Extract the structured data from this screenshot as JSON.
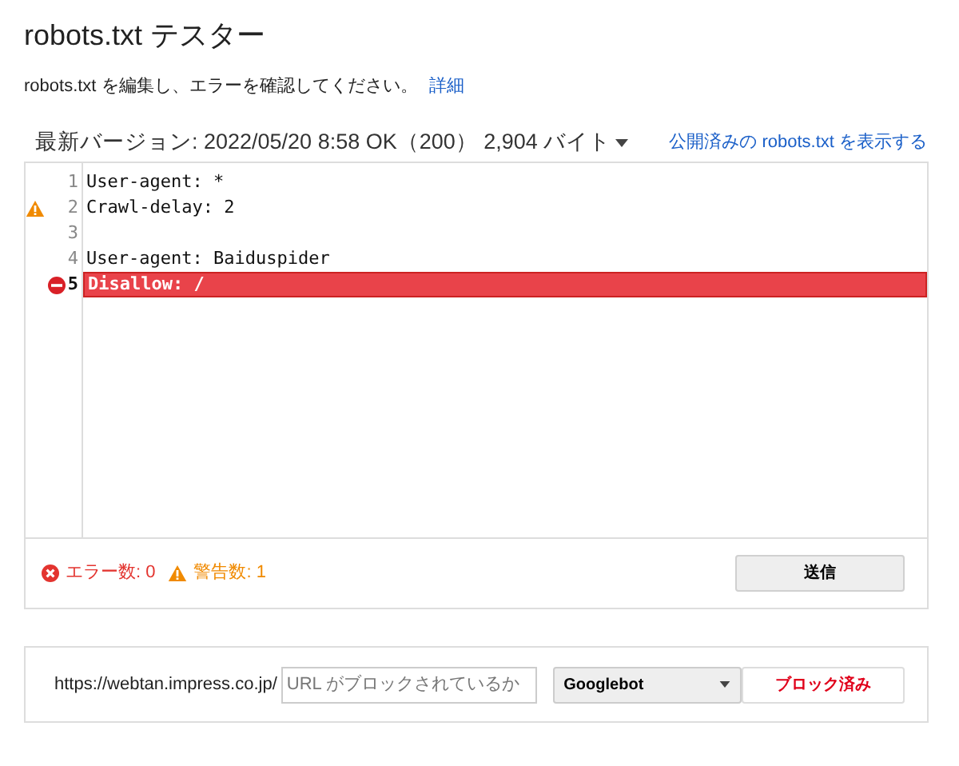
{
  "title": "robots.txt テスター",
  "intro": {
    "text": "robots.txt を編集し、エラーを確認してください。",
    "link": "詳細"
  },
  "version": {
    "label": "最新バージョン: 2022/05/20 8:58 OK（200） 2,904 バイト",
    "link": "公開済みの robots.txt を表示する"
  },
  "editor_lines": [
    {
      "number": "1",
      "text": "User-agent: *",
      "warning": false,
      "error": false
    },
    {
      "number": "2",
      "text": "Crawl-delay: 2",
      "warning": true,
      "error": false
    },
    {
      "number": "3",
      "warning": false,
      "error": false
    },
    {
      "number": "4",
      "text": "User-agent: Baiduspider",
      "warning": false,
      "error": false
    },
    {
      "number": "5",
      "text": "Disallow: /",
      "warning": false,
      "error": true
    }
  ],
  "status": {
    "errors": "エラー数: 0",
    "warnings": "警告数: 1",
    "submit": "送信"
  },
  "test": {
    "base_url": "https://webtan.impress.co.jp/",
    "placeholder": "URL がブロックされているか",
    "agent": "Googlebot",
    "result": "ブロック済み"
  }
}
